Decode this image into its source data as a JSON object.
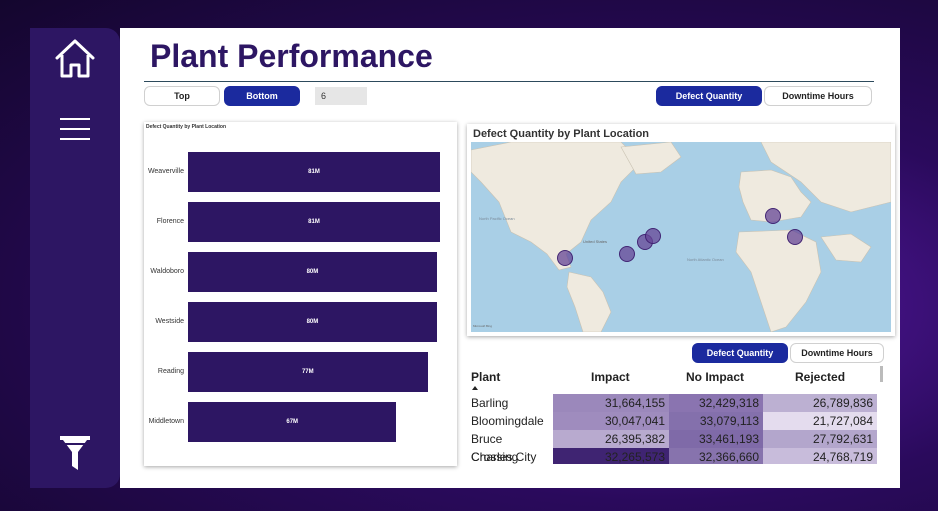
{
  "sidebar": {
    "home_icon": "home-icon",
    "menu_icon": "hamburger-icon",
    "filter_icon": "filter-icon"
  },
  "header": {
    "title": "Plant Performance"
  },
  "controls": {
    "top_label": "Top",
    "bottom_label": "Bottom",
    "n_value": "6",
    "defect_qty_label": "Defect Quantity",
    "downtime_label": "Downtime Hours"
  },
  "bar_chart": {
    "title": "Defect Quantity by Plant Location",
    "chart_data": {
      "type": "bar",
      "orientation": "horizontal",
      "categories": [
        "Weaverville",
        "Florence",
        "Waldoboro",
        "Westside",
        "Reading",
        "Middletown"
      ],
      "values": [
        81,
        81,
        80,
        80,
        77,
        67
      ],
      "value_labels": [
        "81M",
        "81M",
        "80M",
        "80M",
        "77M",
        "67M"
      ],
      "xlim": [
        0,
        81
      ],
      "colors": {
        "bar": "#2d1663"
      }
    }
  },
  "map": {
    "title": "Defect Quantity by Plant Location",
    "labels": [
      "North Pacific Ocean",
      "United States",
      "North Atlantic Ocean"
    ],
    "attribution": "Microsoft Bing"
  },
  "table_controls": {
    "defect_qty_label": "Defect Quantity",
    "downtime_label": "Downtime Hours"
  },
  "table": {
    "headers": [
      "Plant",
      "Impact",
      "No Impact",
      "Rejected"
    ],
    "rows": [
      [
        "Barling",
        "31,664,155",
        "32,429,318",
        "26,789,836"
      ],
      [
        "Bloomingdale",
        "30,047,041",
        "33,079,113",
        "21,727,084"
      ],
      [
        "Bruce Crossing",
        "26,395,382",
        "33,461,193",
        "27,792,631"
      ],
      [
        "Charles City",
        "32,265,573",
        "32,366,660",
        "24,768,719"
      ]
    ],
    "shading": [
      [
        "#9b88bb",
        "#8a74b0",
        "#bcb0d2"
      ],
      [
        "#9f8cbe",
        "#8470ac",
        "#e4dcee"
      ],
      [
        "#b8aacf",
        "#7f6aa8",
        "#b3a6cc"
      ],
      [
        "#3f2472",
        "#8773ad",
        "#c8bcdb"
      ]
    ]
  }
}
